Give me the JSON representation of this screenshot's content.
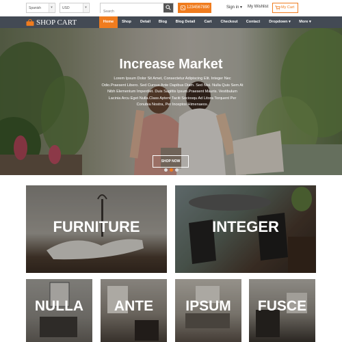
{
  "topbar": {
    "language": "Spanish",
    "currency": "USD",
    "search_placeholder": "Search",
    "phone": "1234567890",
    "sign_in": "Sign in ▾",
    "wishlist": "My Wishlist",
    "cart": "My Cart"
  },
  "nav": {
    "logo": "SHOP CART",
    "items": [
      "Home",
      "Shop",
      "Detail",
      "Blog",
      "Blog Detail",
      "Cart",
      "Checkout",
      "Contact",
      "Dropdown ▾",
      "More ▾"
    ],
    "active": "Home"
  },
  "hero": {
    "title": "Increase Market",
    "text": "Lorem Ipsum Dolor Sit Amet, Consectetur Adipiscing Elit. Integer Nec Odio.Praesent Libero. Sed Cursus Ante Dapibus Diam. Sed Nisi. Nulla Quis Sem At Nibh Elementum Imperdiet. Duis Sagittis Ipsum.Praesent Mauris. Vestibulum Lacinia Arcu Eget Nulla.Class Aptent Taciti Sociosqu Ad Litora Torquent Per Conubia Nostra, Per Inceptos Himenaeos.",
    "button": "SHOP NOW"
  },
  "categories": [
    "FURNITURE",
    "INTEGER",
    "NULLA",
    "ANTE",
    "IPSUM",
    "FUSCE"
  ],
  "colors": {
    "accent": "#f07c1e",
    "nav_bg": "#434a54"
  }
}
